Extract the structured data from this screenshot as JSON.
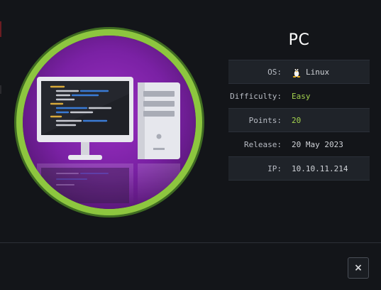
{
  "machine": {
    "name": "PC",
    "avatar_icon": "computer-workstation-icon",
    "difficulty_ring_color": "#8dc63f"
  },
  "info": {
    "os_label": "OS:",
    "os_value": "Linux",
    "os_icon": "linux-tux-icon",
    "difficulty_label": "Difficulty:",
    "difficulty_value": "Easy",
    "points_label": "Points:",
    "points_value": "20",
    "release_label": "Release:",
    "release_value": "20 May 2023",
    "ip_label": "IP:",
    "ip_value": "10.10.11.214"
  },
  "footer": {
    "close_label": "×",
    "close_icon": "close-icon"
  },
  "colors": {
    "background": "#131519",
    "accent_green": "#a4d34e",
    "row_shade": "#1f2329"
  }
}
